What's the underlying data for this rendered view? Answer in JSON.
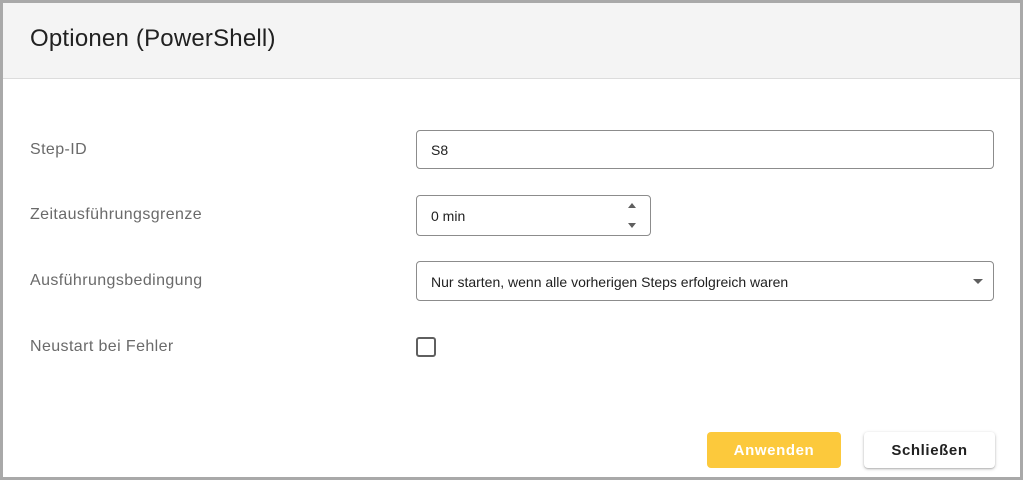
{
  "dialog": {
    "title": "Optionen (PowerShell)"
  },
  "fields": {
    "step_id": {
      "label": "Step-ID",
      "value": "S8"
    },
    "time_limit": {
      "label": "Zeitausführungsgrenze",
      "value": "0 min"
    },
    "condition": {
      "label": "Ausführungsbedingung",
      "value": "Nur starten, wenn alle vorherigen Steps erfolgreich waren"
    },
    "restart": {
      "label": "Neustart bei Fehler",
      "checked": false
    }
  },
  "buttons": {
    "apply_label": "Anwenden",
    "close_label": "Schließen"
  },
  "colors": {
    "accent": "#fcc93c",
    "header_bg": "#f4f4f4",
    "label": "#6a6a6a"
  },
  "icons": {
    "spinner": [
      "spin-up-icon",
      "spin-down-icon"
    ],
    "dropdown": "dropdown-caret-icon"
  }
}
